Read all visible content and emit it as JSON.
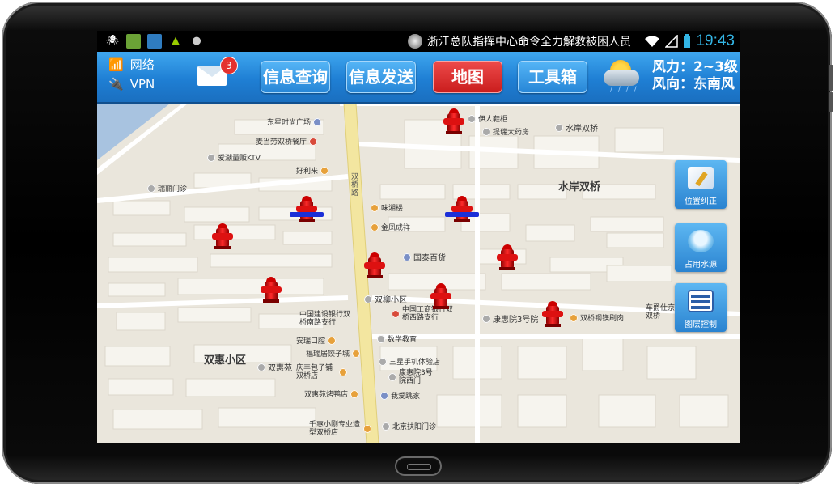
{
  "status_bar": {
    "notification": "浙江总队指挥中心命令全力解救被困人员",
    "time": "19:43",
    "icons": [
      "usb-debug-icon",
      "sim-card-icon",
      "download-icon",
      "android-icon",
      "cat-icon",
      "wifi-icon",
      "signal-icon",
      "battery-icon"
    ]
  },
  "toolbar": {
    "network_label": "网络",
    "vpn_label": "VPN",
    "mail_count": "3",
    "buttons": [
      "信息查询",
      "信息发送",
      "地图",
      "工具箱"
    ],
    "active_button": "地图",
    "wind_force": "风力：2~3级",
    "wind_direction": "风向：东南风"
  },
  "map": {
    "road_label": "双桥路",
    "area_labels": [
      "水岸双桥",
      "双惠小区"
    ],
    "pois": [
      "东星时尚广场",
      "麦当劳双桥餐厅",
      "爱潮量贩KTV",
      "好利来",
      "瑞丽门诊",
      "伊人鞋柜",
      "提瑞大药房",
      "水岸双桥",
      "味湘楼",
      "金凤成祥",
      "国泰百货",
      "双柳小区",
      "中国建设银行双桥南路支行",
      "中国工商银行双桥西路支行",
      "康惠院3号院",
      "双桥钢镁刷肉",
      "车爵仕京双桥",
      "安瑞口腔",
      "福瑞居饺子城",
      "数学教育",
      "三星手机体验店",
      "庆丰包子铺双桥店",
      "双惠苑",
      "康惠院3号院西门",
      "双惠苑烤鸭店",
      "我爱跳家",
      "千惠小刚专业造型双桥店",
      "北京扶阳门诊"
    ]
  },
  "side_tools": [
    "位置纠正",
    "占用水源",
    "图层控制"
  ],
  "colors": {
    "toolbar_blue": "#2685d6",
    "active_red": "#c91c1c",
    "hydrant_red": "#e01010",
    "highlight_bar": "#1b2fd8",
    "road_yellow": "#f3e6a0"
  }
}
